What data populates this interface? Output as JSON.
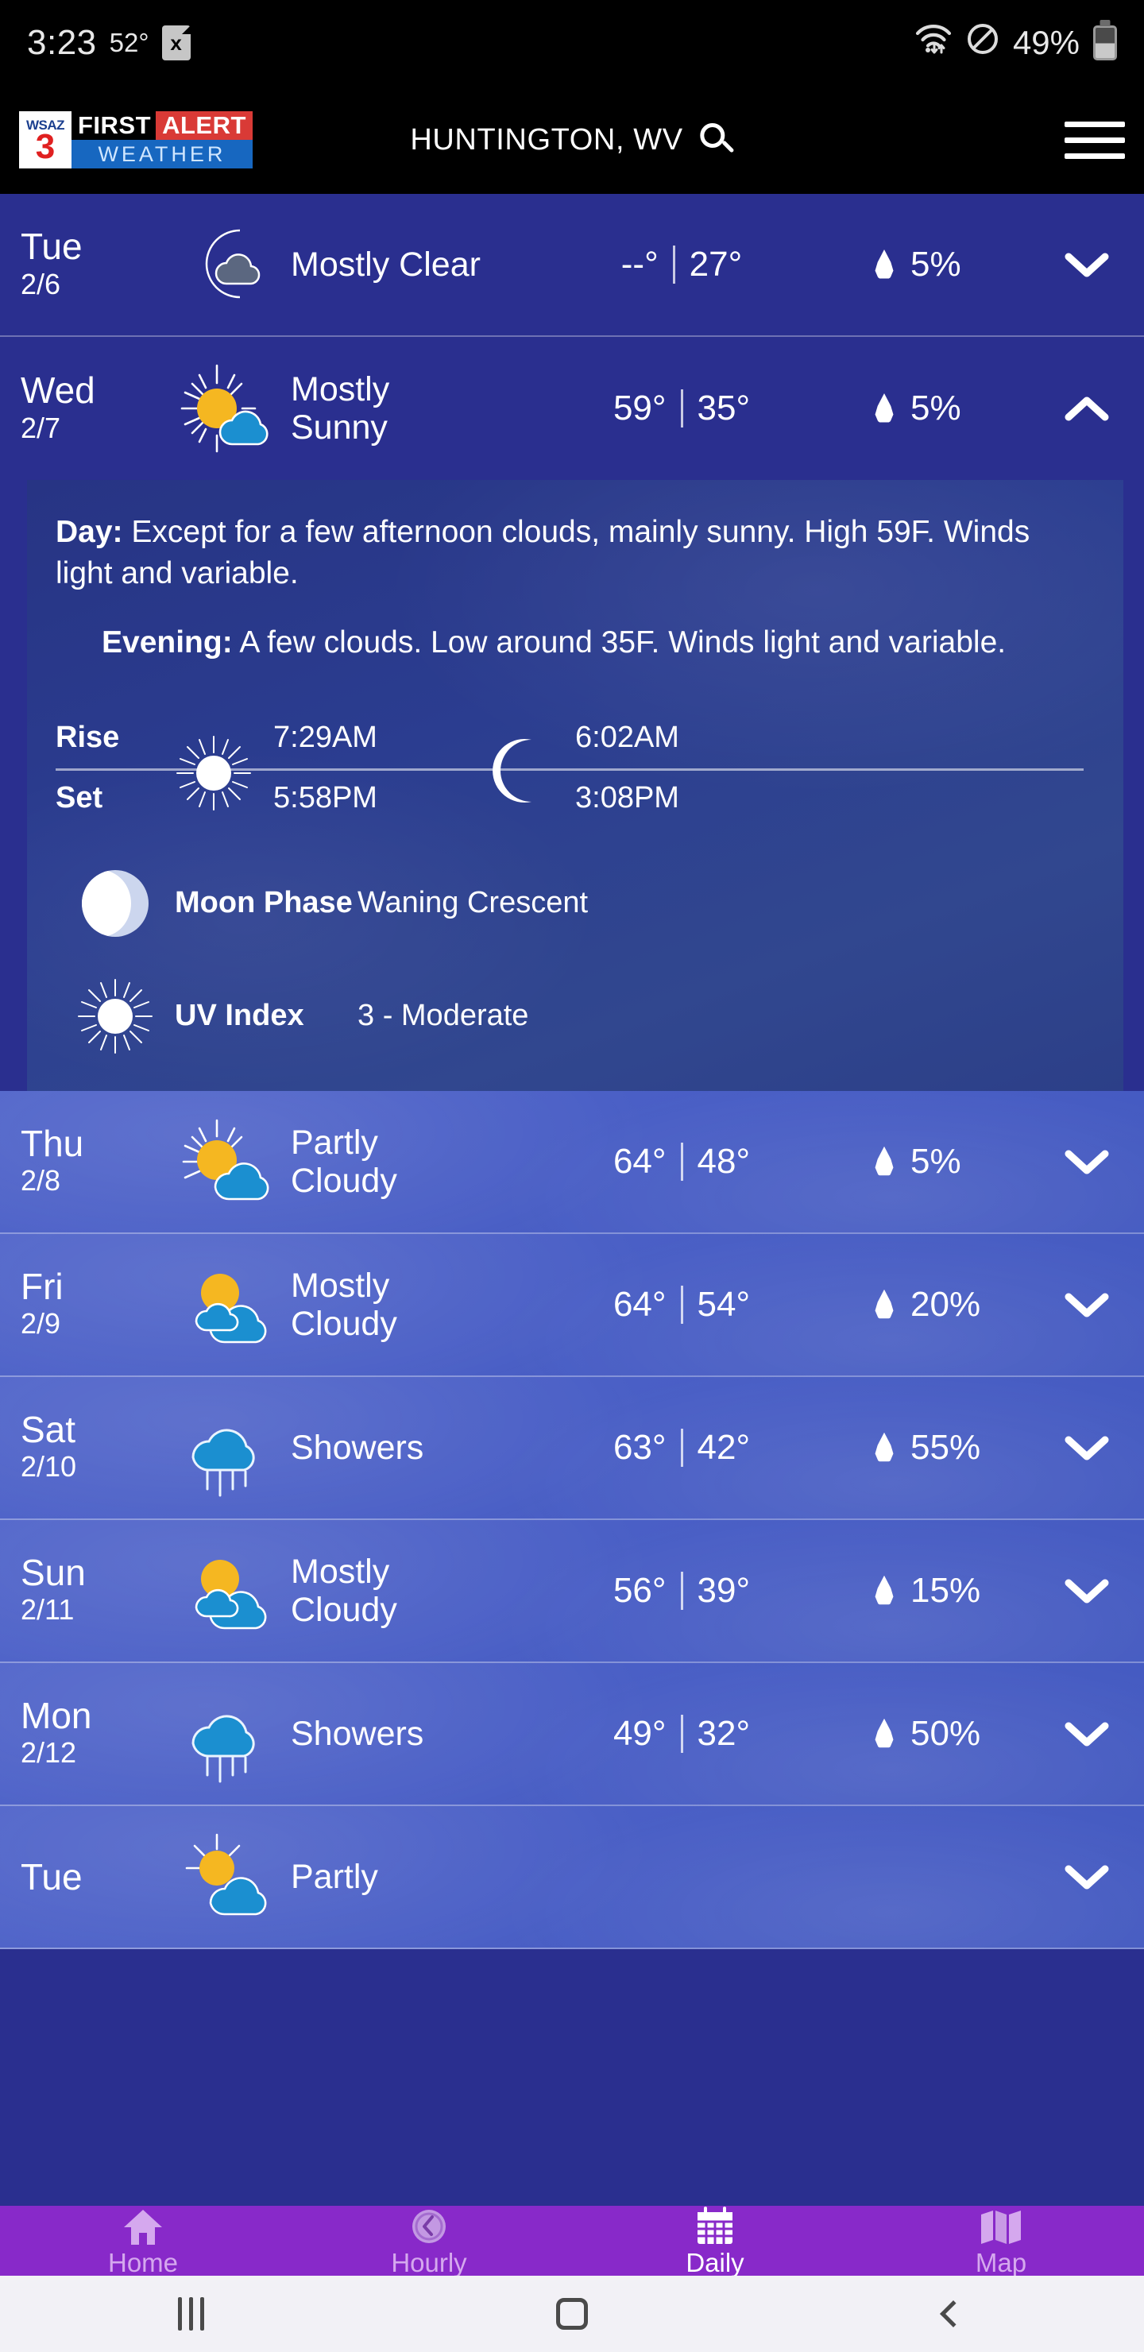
{
  "status_bar": {
    "time": "3:23",
    "temperature": "52°",
    "doc_icon_glyph": "x",
    "doc_icon_name": "document-x-icon",
    "wifi_icon_name": "wifi-data-icon",
    "dnd_icon_name": "do-not-disturb-icon",
    "battery_percent": "49%",
    "battery_level": 49
  },
  "header": {
    "logo": {
      "station": "WSAZ",
      "channel": "3",
      "first": "FIRST",
      "alert": "ALERT",
      "weather": "WEATHER"
    },
    "location": "HUNTINGTON, WV",
    "search_icon_name": "search-icon",
    "menu_icon_name": "hamburger-menu-icon"
  },
  "colors": {
    "dark_row": "#2a2f8f",
    "light_row": "#4a5fc6",
    "nav_bar": "#8829c9",
    "nav_active": "#ffffff",
    "nav_inactive": "#d5a8ee",
    "accent_red": "#d93a36",
    "accent_blue": "#1767c0",
    "sun_yellow": "#f5b721",
    "cloud_blue": "#1b8fd0",
    "moon_gold": "#d8a93c"
  },
  "forecast": [
    {
      "day": "Tue",
      "date": "2/6",
      "icon": "moon-cloud-icon",
      "condition": "Mostly Clear",
      "high": "--°",
      "low": "27°",
      "separator": "|",
      "precip": "5%",
      "chevron": "chevron-down-icon",
      "expanded": false,
      "theme": "dark"
    },
    {
      "day": "Wed",
      "date": "2/7",
      "icon": "sun-cloud-icon",
      "condition": "Mostly Sunny",
      "high": "59°",
      "low": "35°",
      "separator": "|",
      "precip": "5%",
      "chevron": "chevron-up-icon",
      "expanded": true,
      "theme": "dark",
      "detail": {
        "day_label": "Day:",
        "day_text": " Except for a few afternoon clouds, mainly sunny. High 59F. Winds light and variable.",
        "evening_label": "Evening:",
        "evening_text": " A few clouds. Low around 35F. Winds light and variable.",
        "rise_label": "Rise",
        "set_label": "Set",
        "sun_rise": "7:29AM",
        "sun_set": "5:58PM",
        "moon_rise": "6:02AM",
        "moon_set": "3:08PM",
        "sun_icon": "sun-icon",
        "moon_icon": "crescent-moon-icon",
        "moon_phase_label": "Moon Phase",
        "moon_phase_value": "Waning Crescent",
        "moon_phase_icon": "moon-phase-icon",
        "uv_label": "UV Index",
        "uv_value": "3 - Moderate",
        "uv_icon": "uv-sun-icon"
      }
    },
    {
      "day": "Thu",
      "date": "2/8",
      "icon": "sun-cloud-icon",
      "condition": "Partly Cloudy",
      "high": "64°",
      "low": "48°",
      "separator": "|",
      "precip": "5%",
      "chevron": "chevron-down-icon",
      "expanded": false,
      "theme": "light"
    },
    {
      "day": "Fri",
      "date": "2/9",
      "icon": "sun-cloud-icon",
      "condition": "Mostly Cloudy",
      "high": "64°",
      "low": "54°",
      "separator": "|",
      "precip": "20%",
      "chevron": "chevron-down-icon",
      "expanded": false,
      "theme": "light"
    },
    {
      "day": "Sat",
      "date": "2/10",
      "icon": "rain-cloud-icon",
      "condition": "Showers",
      "high": "63°",
      "low": "42°",
      "separator": "|",
      "precip": "55%",
      "chevron": "chevron-down-icon",
      "expanded": false,
      "theme": "light"
    },
    {
      "day": "Sun",
      "date": "2/11",
      "icon": "sun-cloud-icon",
      "condition": "Mostly Cloudy",
      "high": "56°",
      "low": "39°",
      "separator": "|",
      "precip": "15%",
      "chevron": "chevron-down-icon",
      "expanded": false,
      "theme": "light"
    },
    {
      "day": "Mon",
      "date": "2/12",
      "icon": "rain-cloud-icon",
      "condition": "Showers",
      "high": "49°",
      "low": "32°",
      "separator": "|",
      "precip": "50%",
      "chevron": "chevron-down-icon",
      "expanded": false,
      "theme": "light"
    },
    {
      "day": "Tue",
      "date": "",
      "icon": "sun-cloud-icon",
      "condition": "Partly",
      "high": "",
      "low": "",
      "separator": "",
      "precip": "",
      "chevron": "chevron-down-icon",
      "expanded": false,
      "theme": "light"
    }
  ],
  "bottom_nav": [
    {
      "label": "Home",
      "icon": "home-icon",
      "active": false
    },
    {
      "label": "Hourly",
      "icon": "clock-icon",
      "active": false
    },
    {
      "label": "Daily",
      "icon": "calendar-icon",
      "active": true
    },
    {
      "label": "Map",
      "icon": "map-icon",
      "active": false
    }
  ],
  "system_nav": {
    "recent_icon": "recents-icon",
    "home_icon": "home-square-icon",
    "back_icon": "back-chevron-icon"
  }
}
